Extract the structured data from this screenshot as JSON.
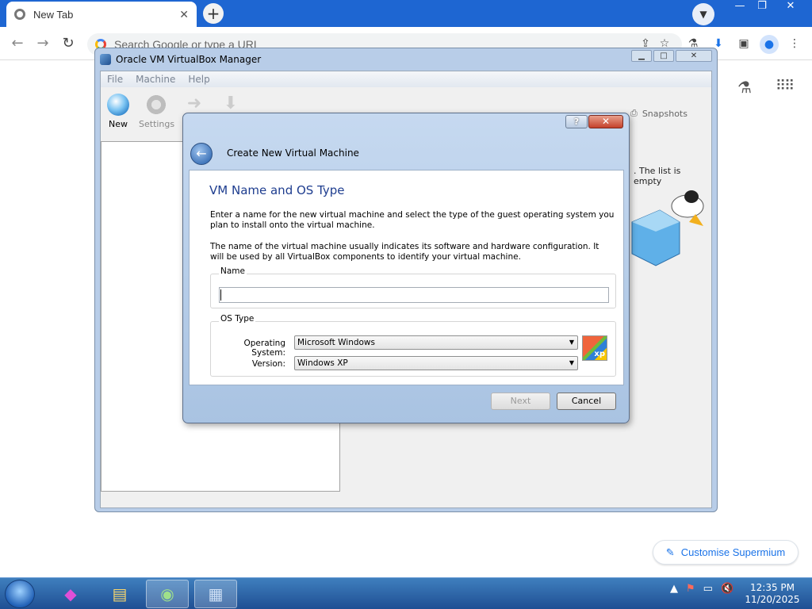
{
  "browser": {
    "tab_title": "New Tab",
    "omnibox_placeholder": "Search Google or type a URL",
    "customise_label": "Customise Supermium"
  },
  "vbox": {
    "window_title": "Oracle VM VirtualBox Manager",
    "menu": [
      "File",
      "Machine",
      "Help"
    ],
    "toolbar": {
      "new_label": "New",
      "settings_label": "Settings"
    },
    "snapshots_label": "Snapshots",
    "empty_list_text": ". The list is empty"
  },
  "dialog": {
    "title": "Create New Virtual Machine",
    "page_header": "VM Name and OS Type",
    "para1": "Enter a name for the new virtual machine and select the type of the guest operating system you plan to install onto the virtual machine.",
    "para2": "The name of the virtual machine usually indicates its software and hardware configuration. It will be used by all VirtualBox components to identify your virtual machine.",
    "name_group_label": "Name",
    "name_value": "",
    "os_group_label": "OS Type",
    "os_label": "Operating System:",
    "os_value": "Microsoft Windows",
    "version_label": "Version:",
    "version_value": "Windows XP",
    "os_icon_text": "xp",
    "next_label": "Next",
    "cancel_label": "Cancel",
    "help_label": "?",
    "close_label": "✕"
  },
  "taskbar": {
    "time": "12:35 PM",
    "date": "11/20/2025"
  },
  "colors": {
    "chrome_blue": "#1e66d2",
    "dialog_header_blue": "#1e3d8f",
    "link_blue": "#1a73e8"
  }
}
